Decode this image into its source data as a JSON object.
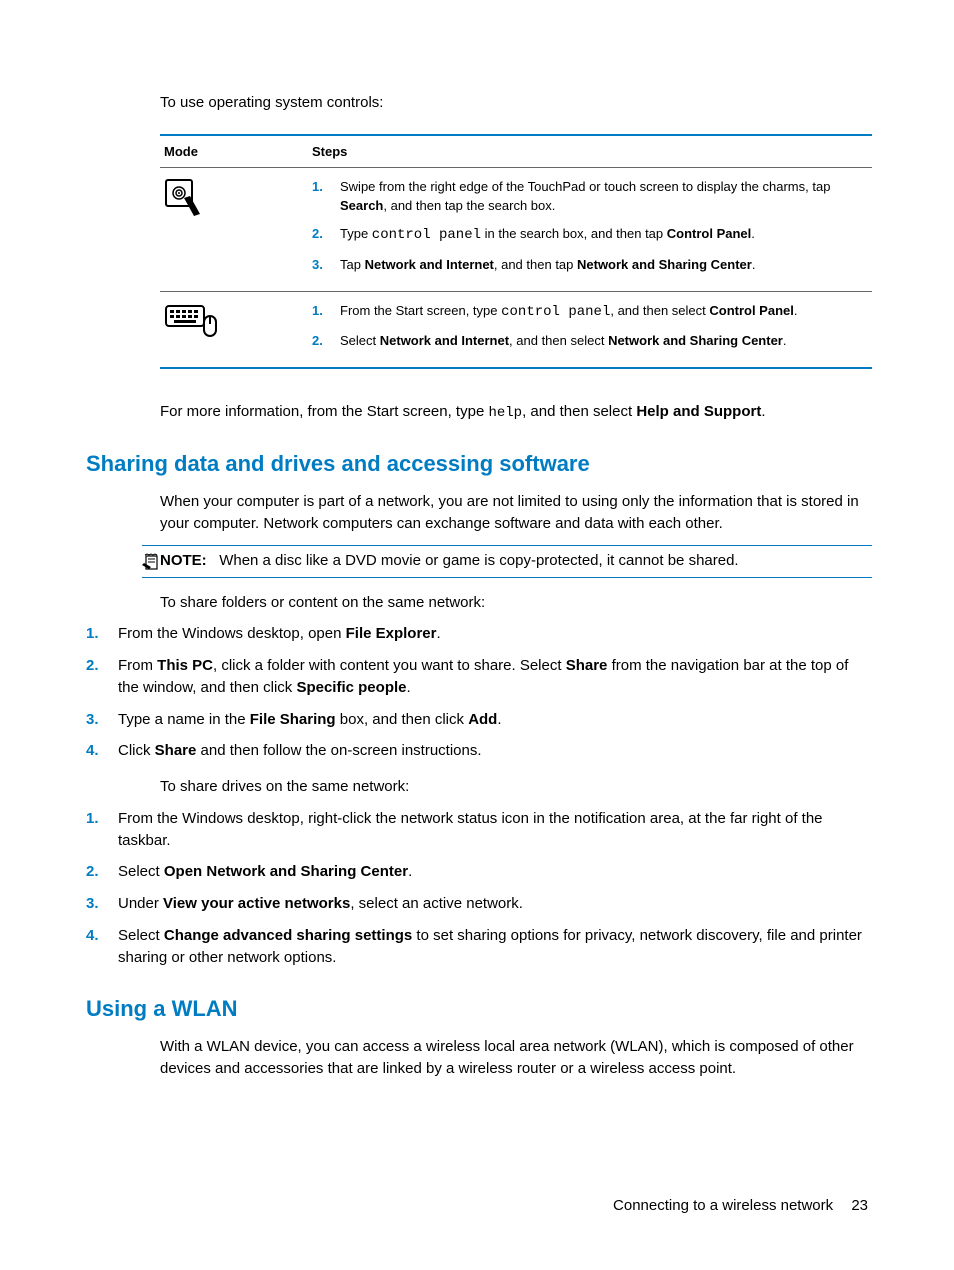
{
  "intro": "To use operating system controls:",
  "table": {
    "headers": {
      "mode": "Mode",
      "steps": "Steps"
    },
    "row1": {
      "s1_a": "Swipe from the right edge of the TouchPad or touch screen to display the charms, tap ",
      "s1_b": "Search",
      "s1_c": ", and then tap the search box.",
      "s2_a": "Type ",
      "s2_code": "control panel",
      "s2_b": " in the search box, and then tap ",
      "s2_c": "Control Panel",
      "s2_d": ".",
      "s3_a": "Tap ",
      "s3_b": "Network and Internet",
      "s3_c": ", and then tap ",
      "s3_d": "Network and Sharing Center",
      "s3_e": "."
    },
    "row2": {
      "s1_a": "From the Start screen, type ",
      "s1_code": "control panel",
      "s1_b": ", and then select ",
      "s1_c": "Control Panel",
      "s1_d": ".",
      "s2_a": "Select ",
      "s2_b": "Network and Internet",
      "s2_c": ", and then select ",
      "s2_d": "Network and Sharing Center",
      "s2_e": "."
    }
  },
  "moreinfo": {
    "a": "For more information, from the Start screen, type ",
    "code": "help",
    "b": ", and then select ",
    "c": "Help and Support",
    "d": "."
  },
  "h_sharing": "Sharing data and drives and accessing software",
  "sharing_p1": "When your computer is part of a network, you are not limited to using only the information that is stored in your computer. Network computers can exchange software and data with each other.",
  "note": {
    "label": "NOTE:",
    "text": "When a disc like a DVD movie or game is copy-protected, it cannot be shared."
  },
  "share_intro": "To share folders or content on the same network:",
  "share_steps": {
    "s1_a": "From the Windows desktop, open ",
    "s1_b": "File Explorer",
    "s1_c": ".",
    "s2_a": "From ",
    "s2_b": "This PC",
    "s2_c": ", click a folder with content you want to share. Select ",
    "s2_d": "Share",
    "s2_e": " from the navigation bar at the top of the window, and then click ",
    "s2_f": "Specific people",
    "s2_g": ".",
    "s3_a": "Type a name in the ",
    "s3_b": "File Sharing",
    "s3_c": " box, and then click ",
    "s3_d": "Add",
    "s3_e": ".",
    "s4_a": "Click ",
    "s4_b": "Share",
    "s4_c": " and then follow the on-screen instructions."
  },
  "drives_intro": "To share drives on the same network:",
  "drives_steps": {
    "s1": "From the Windows desktop, right-click the network status icon in the notification area, at the far right of the taskbar.",
    "s2_a": "Select ",
    "s2_b": "Open Network and Sharing Center",
    "s2_c": ".",
    "s3_a": "Under ",
    "s3_b": "View your active networks",
    "s3_c": ", select an active network.",
    "s4_a": "Select ",
    "s4_b": "Change advanced sharing settings",
    "s4_c": " to set sharing options for privacy, network discovery, file and printer sharing or other network options."
  },
  "h_wlan": "Using a WLAN",
  "wlan_p1": "With a WLAN device, you can access a wireless local area network (WLAN), which is composed of other devices and accessories that are linked by a wireless router or a wireless access point.",
  "footer": {
    "title": "Connecting to a wireless network",
    "page": "23"
  },
  "nums": {
    "n1": "1.",
    "n2": "2.",
    "n3": "3.",
    "n4": "4."
  }
}
